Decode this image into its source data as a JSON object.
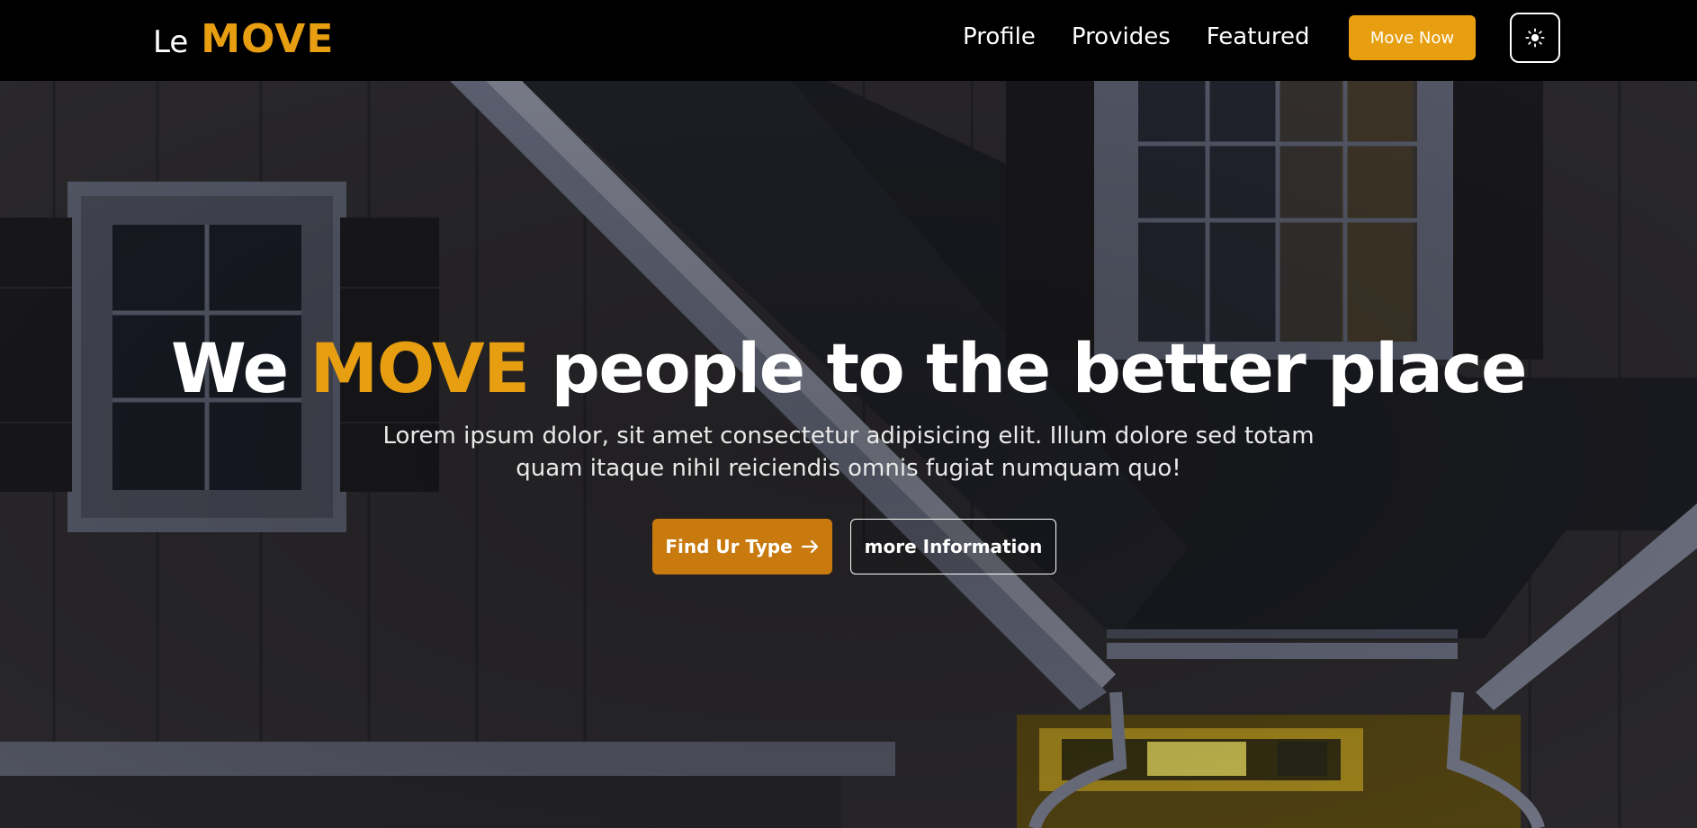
{
  "brand": {
    "prefix": "Le",
    "name": "MOVE"
  },
  "nav": {
    "links": [
      "Profile",
      "Provides",
      "Featured"
    ],
    "cta_label": "Move Now",
    "theme_toggle_icon": "sun-icon"
  },
  "hero": {
    "title_pre": "We",
    "title_accent": "MOVE",
    "title_post": "people to the better place",
    "subtitle": "Lorem ipsum dolor, sit amet consectetur adipisicing elit. Illum dolore sed totam quam itaque nihil reiciendis omnis fugiat numquam quo!",
    "primary_label": "Find Ur Type",
    "primary_icon": "arrow-right-icon",
    "secondary_label": "more Information"
  },
  "colors": {
    "accent": "#e89e11",
    "accent_dark": "#c97a0e",
    "navbar": "#000000"
  }
}
